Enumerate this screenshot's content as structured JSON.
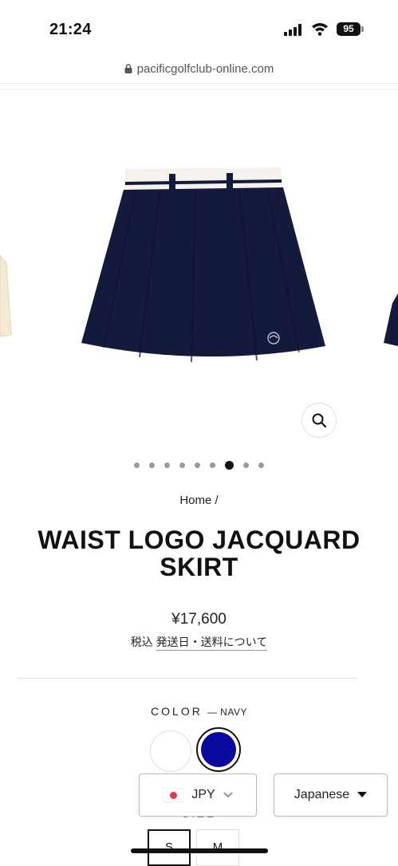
{
  "status_bar": {
    "time": "21:24",
    "battery": "95"
  },
  "browser": {
    "url": "pacificgolfclub-online.com"
  },
  "gallery": {
    "dot_count": 9,
    "active_index": 6
  },
  "product": {
    "breadcrumb": "Home /",
    "title": "WAIST LOGO JACQUARD SKIRT",
    "price": "¥17,600",
    "tax_label": "税込",
    "shipping_link": "発送日・送料について",
    "color_label": "COLOR",
    "color_value": "— NAVY",
    "colors": [
      "#ffffff",
      "#0a0a9e"
    ],
    "size_label": "SIZE",
    "sizes": [
      "S",
      "M"
    ]
  },
  "pickers": {
    "currency": "JPY",
    "language": "Japanese"
  },
  "colors": {
    "navy_skirt": "#141a3c",
    "swatch_navy": "#0a0a9e",
    "flag_red": "#e3374c"
  }
}
